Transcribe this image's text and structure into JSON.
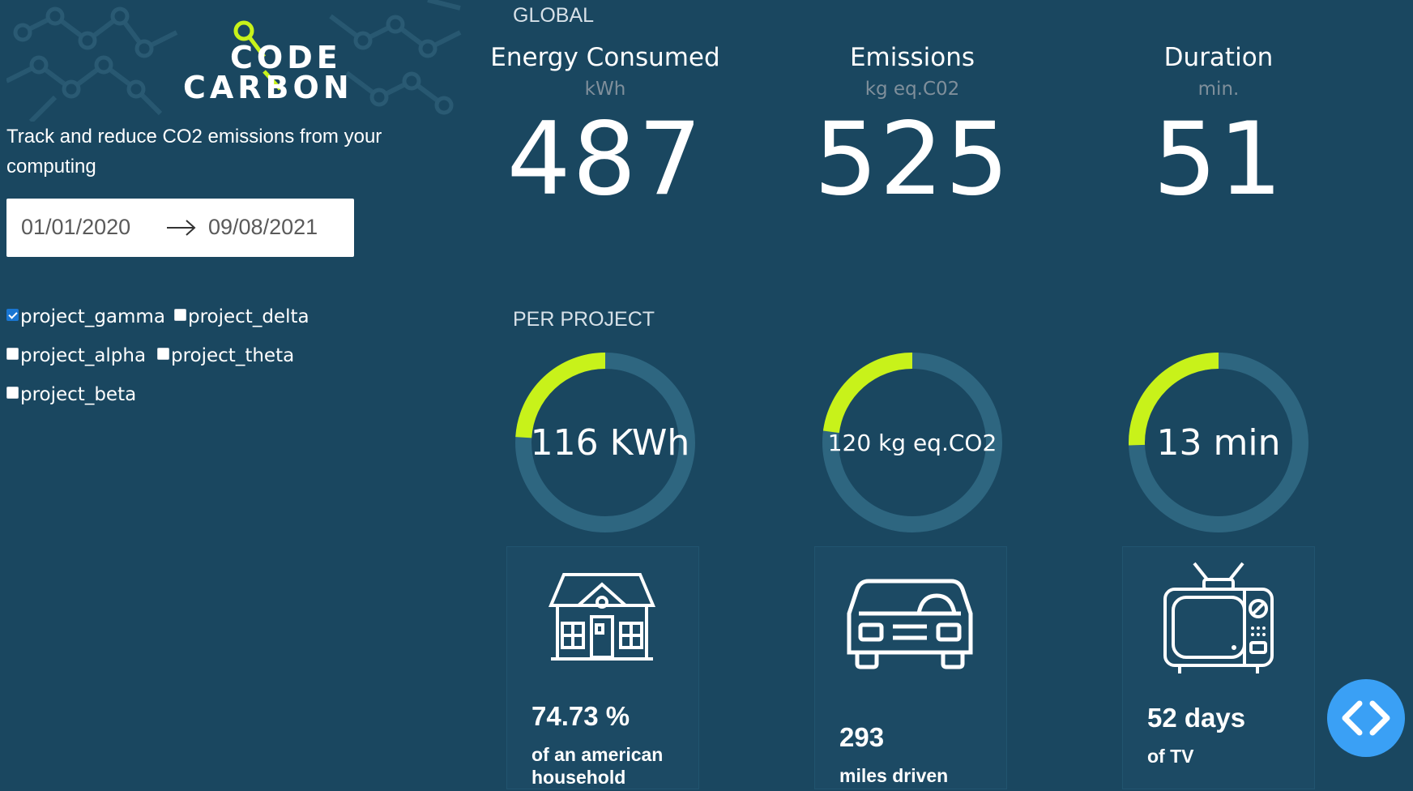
{
  "sidebar": {
    "logo": {
      "line1": "CODE",
      "line2": "CARBON"
    },
    "tagline": "Track and reduce CO2 emissions from your computing",
    "date_range": {
      "start": "01/01/2020",
      "end": "09/08/2021"
    },
    "projects": [
      {
        "label": "project_gamma",
        "checked": true
      },
      {
        "label": "project_delta",
        "checked": false
      },
      {
        "label": "project_alpha",
        "checked": false
      },
      {
        "label": "project_theta",
        "checked": false
      },
      {
        "label": "project_beta",
        "checked": false
      }
    ]
  },
  "global": {
    "heading": "GLOBAL",
    "energy": {
      "title": "Energy Consumed",
      "unit": "kWh",
      "value": "487"
    },
    "emissions": {
      "title": "Emissions",
      "unit": "kg eq.C02",
      "value": "525"
    },
    "duration": {
      "title": "Duration",
      "unit": "min.",
      "value": "51"
    }
  },
  "per_project": {
    "heading": "PER PROJECT",
    "gauges": [
      {
        "label": "116 KWh",
        "fraction": 0.24
      },
      {
        "label": "120 kg eq.CO2",
        "fraction": 0.229
      },
      {
        "label": "13 min",
        "fraction": 0.255
      }
    ],
    "equivalents": [
      {
        "icon": "house-icon",
        "value": "74.73 %",
        "caption": "of an american household"
      },
      {
        "icon": "car-icon",
        "value": "293",
        "caption": "miles driven"
      },
      {
        "icon": "tv-icon",
        "value": "52 days",
        "caption": "of TV"
      }
    ]
  },
  "colors": {
    "background": "#1a4760",
    "accent": "#c8f21a",
    "track": "#2e6680",
    "fab": "#3aa0f5"
  }
}
